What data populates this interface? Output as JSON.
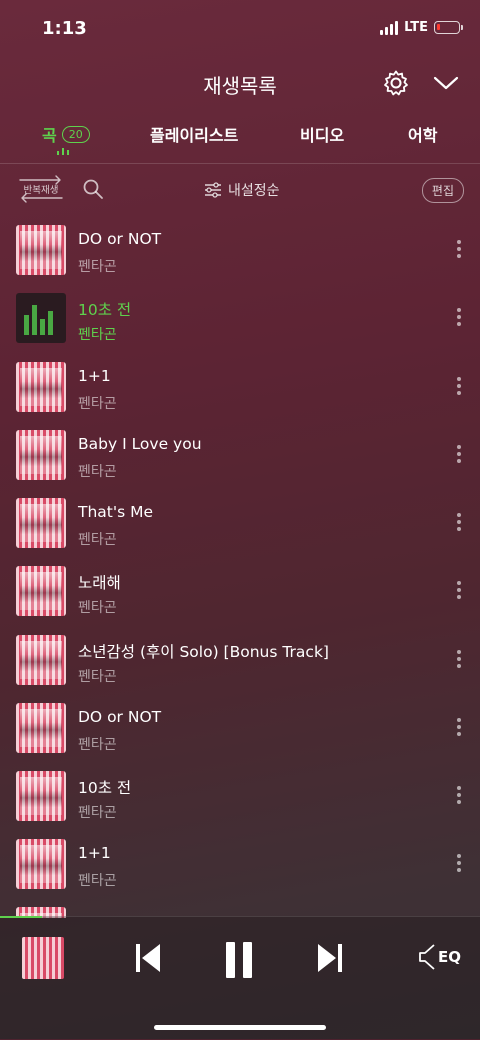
{
  "status": {
    "time": "1:13",
    "network": "LTE"
  },
  "header": {
    "title": "재생목록"
  },
  "tabs": [
    {
      "label": "곡",
      "count": "20"
    },
    {
      "label": "플레이리스트"
    },
    {
      "label": "비디오"
    },
    {
      "label": "어학"
    }
  ],
  "toolbar": {
    "repeat_label": "반복재생",
    "sort_label": "내설정순",
    "edit_label": "편집"
  },
  "songs": [
    {
      "title": "DO or NOT",
      "artist": "펜타곤"
    },
    {
      "title": "10초 전",
      "artist": "펜타곤",
      "playing": true
    },
    {
      "title": "1+1",
      "artist": "펜타곤"
    },
    {
      "title": "Baby I Love you",
      "artist": "펜타곤"
    },
    {
      "title": "That's Me",
      "artist": "펜타곤"
    },
    {
      "title": "노래해",
      "artist": "펜타곤"
    },
    {
      "title": "소년감성 (후이 Solo) [Bonus Track]",
      "artist": "펜타곤"
    },
    {
      "title": "DO or NOT",
      "artist": "펜타곤"
    },
    {
      "title": "10초 전",
      "artist": "펜타곤"
    },
    {
      "title": "1+1",
      "artist": "펜타곤"
    }
  ],
  "player": {
    "eq_label": "EQ"
  },
  "colors": {
    "accent": "#5fd14d",
    "battery_low": "#ff3b30"
  }
}
